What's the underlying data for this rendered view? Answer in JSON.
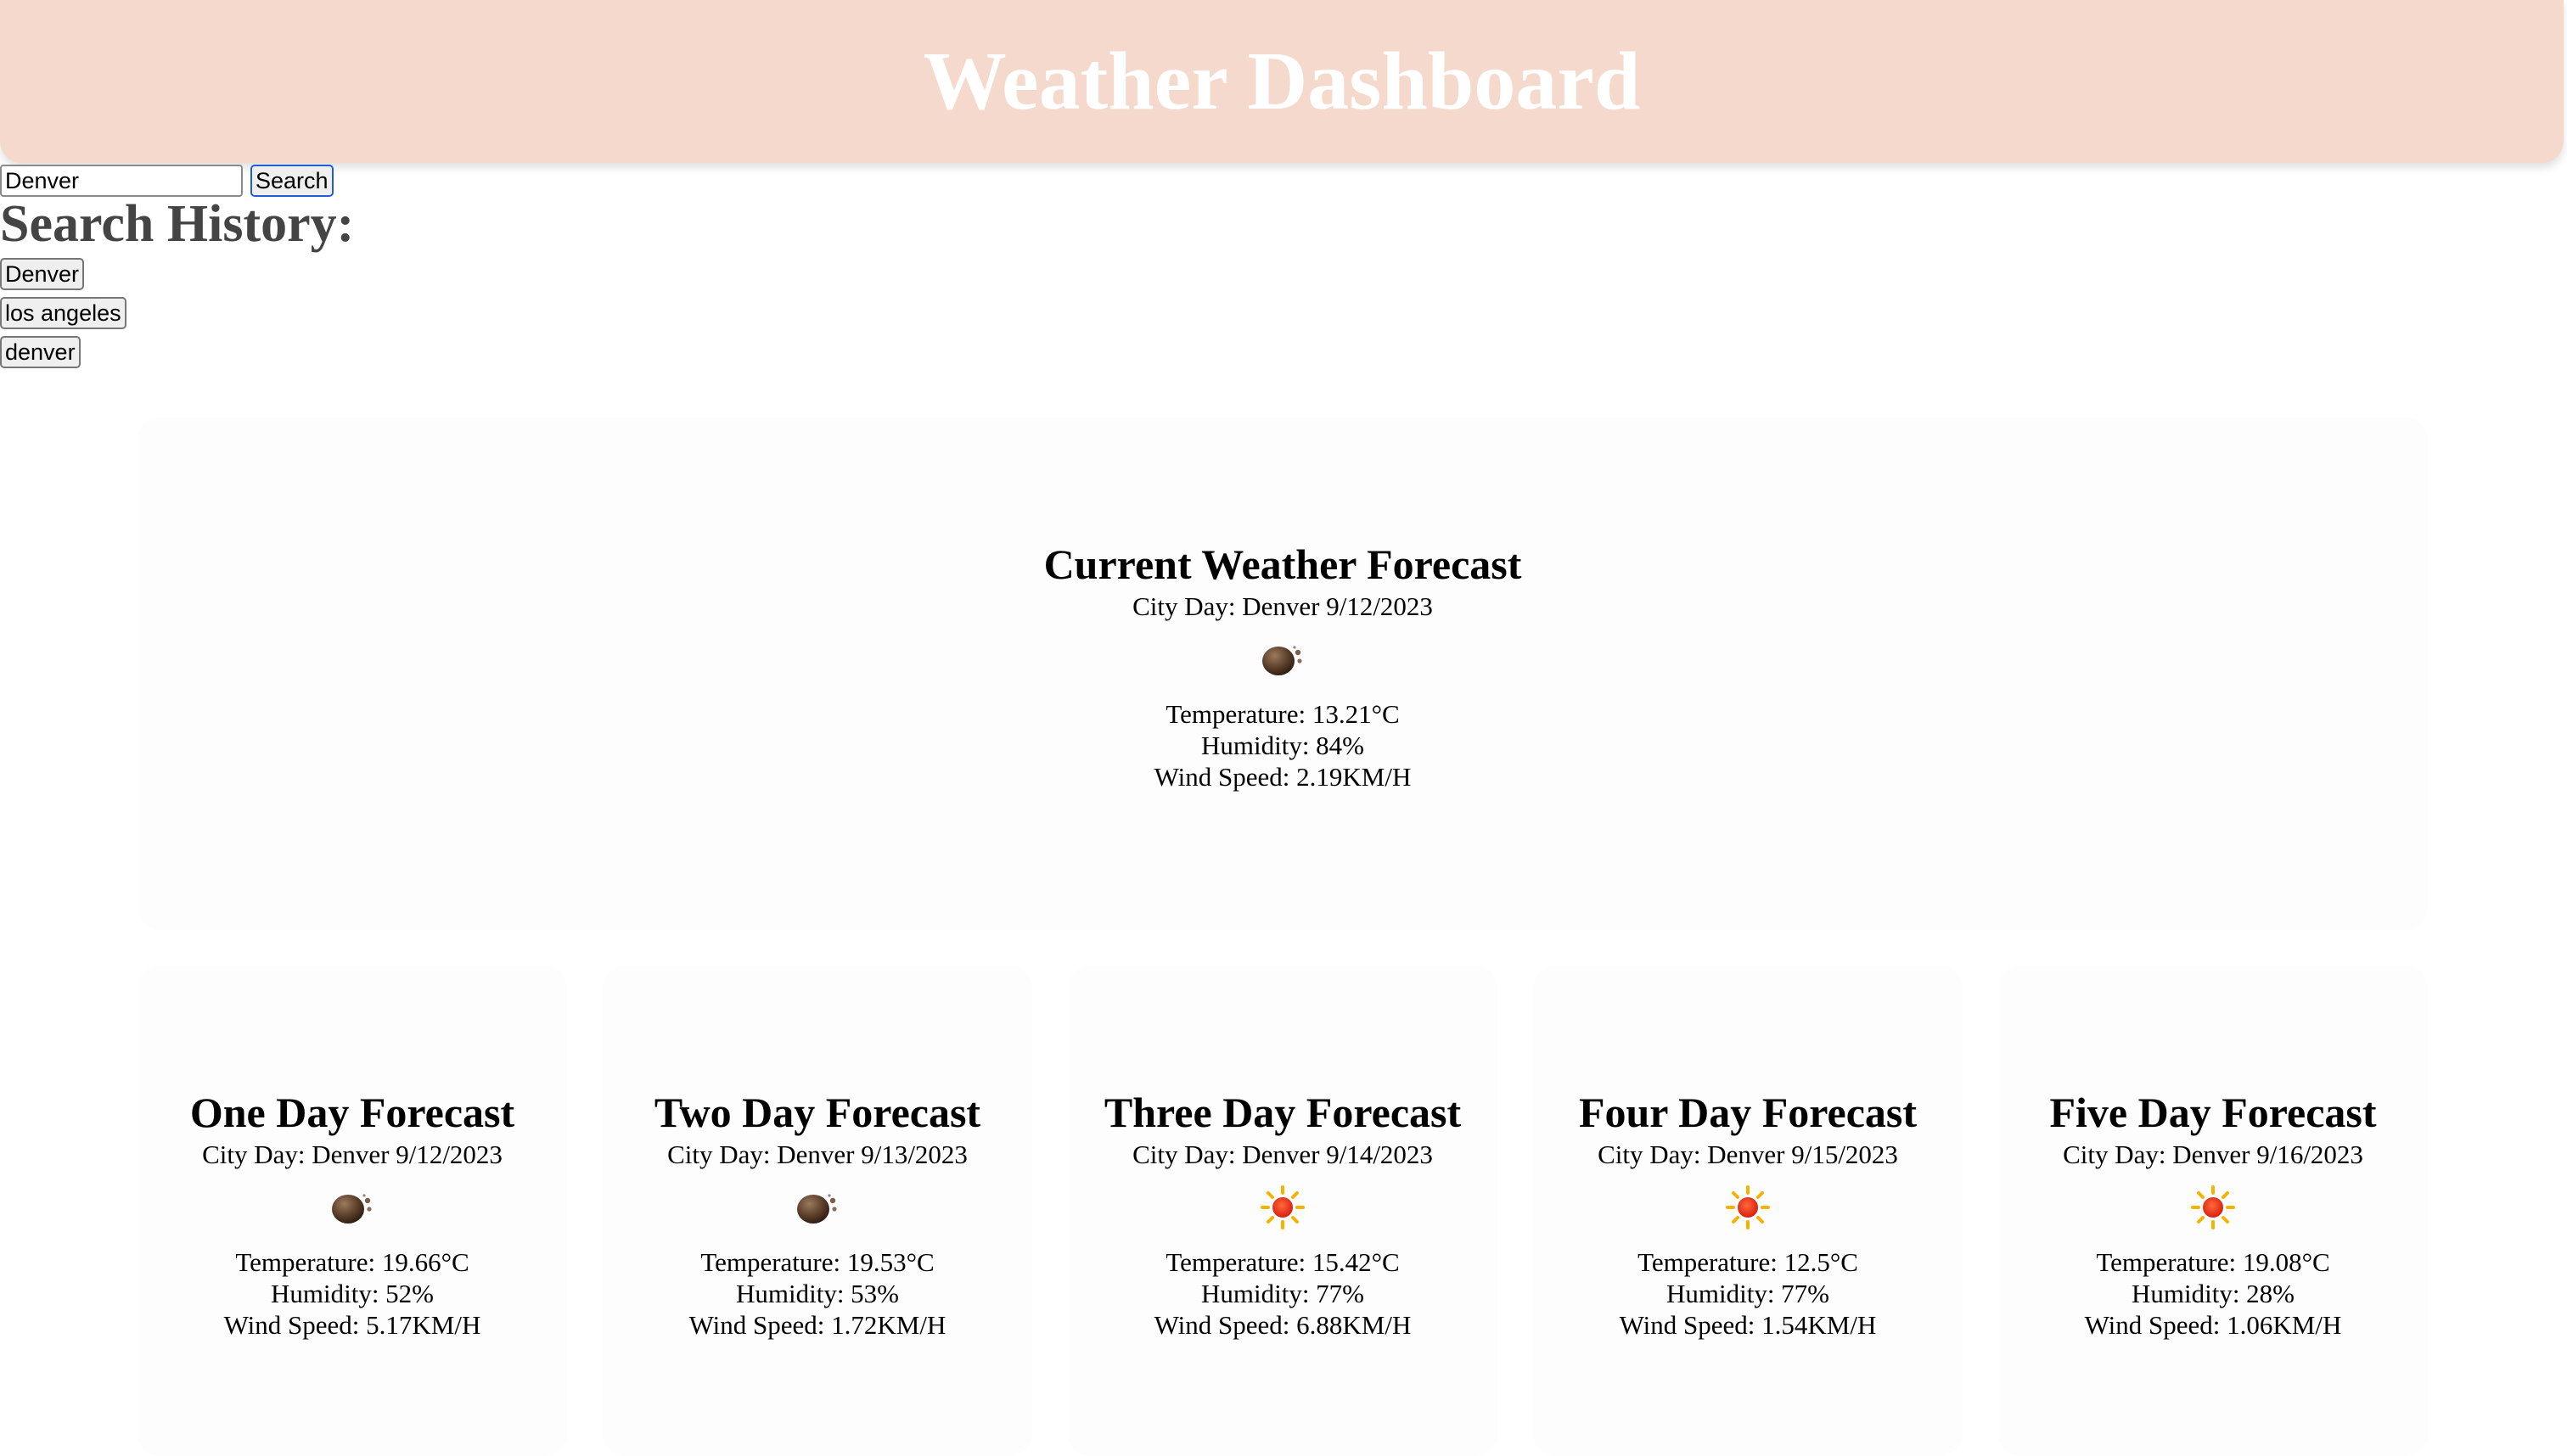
{
  "header": {
    "title": "Weather Dashboard"
  },
  "search": {
    "value": "Denver",
    "button_label": "Search"
  },
  "history": {
    "title": "Search History:",
    "items": [
      "Denver",
      "los angeles",
      "denver"
    ]
  },
  "current": {
    "title": "Current Weather Forecast",
    "city_day": "City Day: Denver 9/12/2023",
    "icon": "night-cloud-icon",
    "temperature": "Temperature: 13.21°C",
    "humidity": "Humidity: 84%",
    "wind": "Wind Speed: 2.19KM/H"
  },
  "forecast": [
    {
      "title": "One Day Forecast",
      "city_day": "City Day: Denver 9/12/2023",
      "icon": "night-cloud-icon",
      "temperature": "Temperature: 19.66°C",
      "humidity": "Humidity: 52%",
      "wind": "Wind Speed: 5.17KM/H"
    },
    {
      "title": "Two Day Forecast",
      "city_day": "City Day: Denver 9/13/2023",
      "icon": "night-cloud-icon",
      "temperature": "Temperature: 19.53°C",
      "humidity": "Humidity: 53%",
      "wind": "Wind Speed: 1.72KM/H"
    },
    {
      "title": "Three Day Forecast",
      "city_day": "City Day: Denver 9/14/2023",
      "icon": "sun-icon",
      "temperature": "Temperature: 15.42°C",
      "humidity": "Humidity: 77%",
      "wind": "Wind Speed: 6.88KM/H"
    },
    {
      "title": "Four Day Forecast",
      "city_day": "City Day: Denver 9/15/2023",
      "icon": "sun-icon",
      "temperature": "Temperature: 12.5°C",
      "humidity": "Humidity: 77%",
      "wind": "Wind Speed: 1.54KM/H"
    },
    {
      "title": "Five Day Forecast",
      "city_day": "City Day: Denver 9/16/2023",
      "icon": "sun-icon",
      "temperature": "Temperature: 19.08°C",
      "humidity": "Humidity: 28%",
      "wind": "Wind Speed: 1.06KM/H"
    }
  ],
  "colors": {
    "header_bg": "#f5d9cc",
    "header_text": "#ffffff",
    "history_title": "#444444",
    "card_bg": "#fdfdfd"
  }
}
